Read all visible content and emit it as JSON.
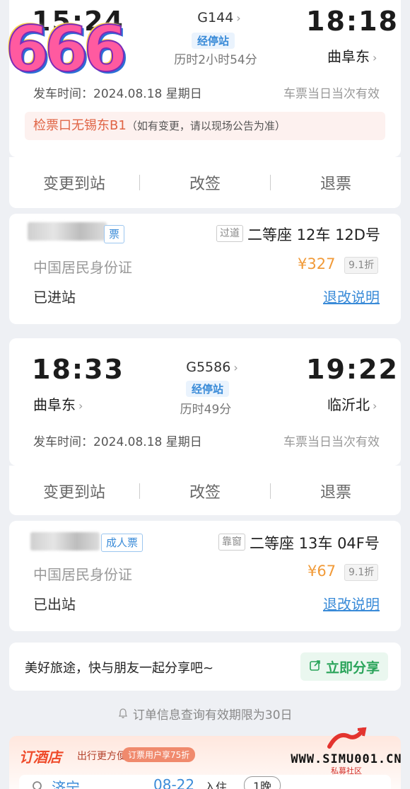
{
  "trip1": {
    "depart_time": "15:24",
    "arrive_time": "18:18",
    "train_no": "G144",
    "stop_badge": "经停站",
    "duration": "历时2小时54分",
    "arrive_station": "曲阜东",
    "depart_date_label": "发车时间：2024.08.18 星期日",
    "valid_label": "车票当日当次有效",
    "notice": "检票口无锡东B1",
    "notice_note": "（如有变更，请以现场公告为准）",
    "actions": [
      "变更到站",
      "改签",
      "退票"
    ],
    "passenger": {
      "ticket_type": "票",
      "tag": "过道",
      "seat": "二等座 12车 12D号",
      "id_type": "中国居民身份证",
      "price": "¥327",
      "discount": "9.1折",
      "status": "已进站",
      "rules_link": "退改说明"
    }
  },
  "trip2": {
    "depart_time": "18:33",
    "arrive_time": "19:22",
    "train_no": "G5586",
    "stop_badge": "经停站",
    "duration": "历时49分",
    "depart_station": "曲阜东",
    "arrive_station": "临沂北",
    "depart_date_label": "发车时间：2024.08.18 星期日",
    "valid_label": "车票当日当次有效",
    "actions": [
      "变更到站",
      "改签",
      "退票"
    ],
    "passenger": {
      "ticket_type": "成人票",
      "tag": "靠窗",
      "seat": "二等座 13车 04F号",
      "id_type": "中国居民身份证",
      "price": "¥67",
      "discount": "9.1折",
      "status": "已出站",
      "rules_link": "退改说明"
    }
  },
  "share": {
    "text": "美好旅途，快与朋友一起分享吧~",
    "button": "立即分享"
  },
  "validity_note": "订单信息查询有效期限为30日",
  "hotel": {
    "title": "订酒店",
    "subtitle": "出行更方便",
    "promo": "订票用户享75折",
    "city": "济宁",
    "date": "08-22",
    "checkin": "入住",
    "nights": "1晚"
  },
  "overlay": {
    "sticker": "666",
    "watermark_url": "WWW.SIMU001.CN",
    "watermark_cn": "私募社区"
  },
  "colors": {
    "accent_blue": "#3a8bd8",
    "price_orange": "#f19a38",
    "notice_red": "#e06445",
    "share_green": "#2aa45a"
  }
}
